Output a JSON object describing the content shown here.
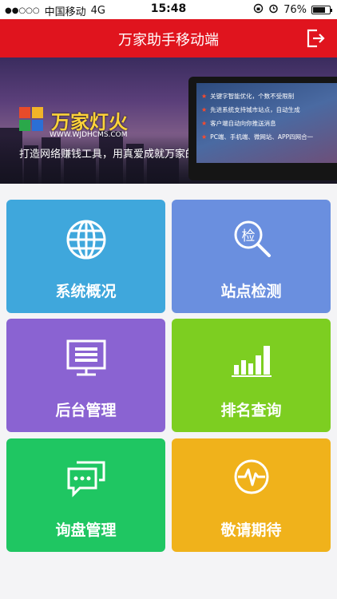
{
  "status_bar": {
    "signal": "●●○○○",
    "carrier": "中国移动",
    "network": "4G",
    "time": "15:48",
    "battery_text": "76%",
    "battery_level": 0.76
  },
  "header": {
    "title": "万家助手移动端",
    "logout_icon": "logout-icon",
    "bg_color": "#e0141e"
  },
  "banner": {
    "brand": "万家灯火",
    "url": "WWW.WJDHCMS.COM",
    "slogan": "打造网络赚钱工具，用真爱成就万家的美",
    "features": [
      "关键字智能优化，个数不受限制",
      "先进系统支持城市站点，自动生成",
      "客户端自动向你推送消息",
      "PC端、手机端、微网站、APP四网合一"
    ],
    "slides": 2,
    "active_slide": 1
  },
  "tiles": [
    {
      "label": "系统概况",
      "icon": "globe-icon",
      "color": "#3fa7dc"
    },
    {
      "label": "站点检测",
      "icon": "search-check-icon",
      "icon_text": "检",
      "color": "#6a8fdf"
    },
    {
      "label": "后台管理",
      "icon": "monitor-icon",
      "color": "#8a63d2"
    },
    {
      "label": "排名查询",
      "icon": "bar-chart-icon",
      "color": "#7dce21"
    },
    {
      "label": "询盘管理",
      "icon": "chat-icon",
      "color": "#1fc662"
    },
    {
      "label": "敬请期待",
      "icon": "pulse-icon",
      "color": "#f0b21b"
    }
  ]
}
